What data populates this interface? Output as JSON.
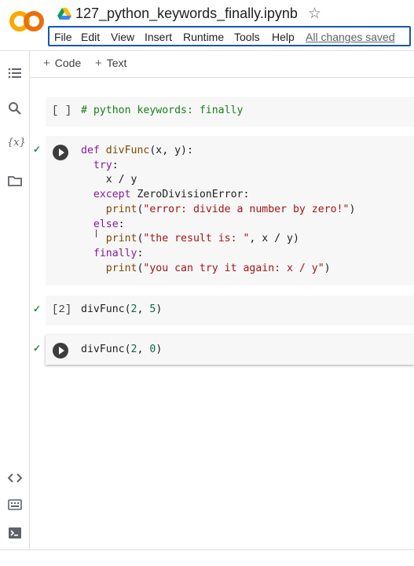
{
  "notebook": {
    "title": "127_python_keywords_finally.ipynb"
  },
  "menu": [
    "File",
    "Edit",
    "View",
    "Insert",
    "Runtime",
    "Tools",
    "Help"
  ],
  "save_status": "All changes saved",
  "toolbar": {
    "code_label": "Code",
    "text_label": "Text"
  },
  "cells": [
    {
      "prompt": "[ ]",
      "code": "# python keywords: finally"
    },
    {
      "prompt": "",
      "code_lines": [
        "def divFunc(x, y):",
        "  try:",
        "    x / y",
        "  except ZeroDivisionError:",
        "    print(\"error: divide a number by zero!\")",
        "  else:",
        "    print(\"the result is: \", x / y)",
        "  finally:",
        "    print(\"you can try it again: x / y\")"
      ]
    },
    {
      "prompt": "[2]",
      "code": "divFunc(2, 5)"
    },
    {
      "prompt": "",
      "code": "divFunc(2, 0)"
    }
  ],
  "colors": {
    "accent": "#1a56b0",
    "check": "#1e8e3e",
    "keyword": "#8a1a9b",
    "string": "#a31515",
    "comment": "#1a7f1a"
  }
}
